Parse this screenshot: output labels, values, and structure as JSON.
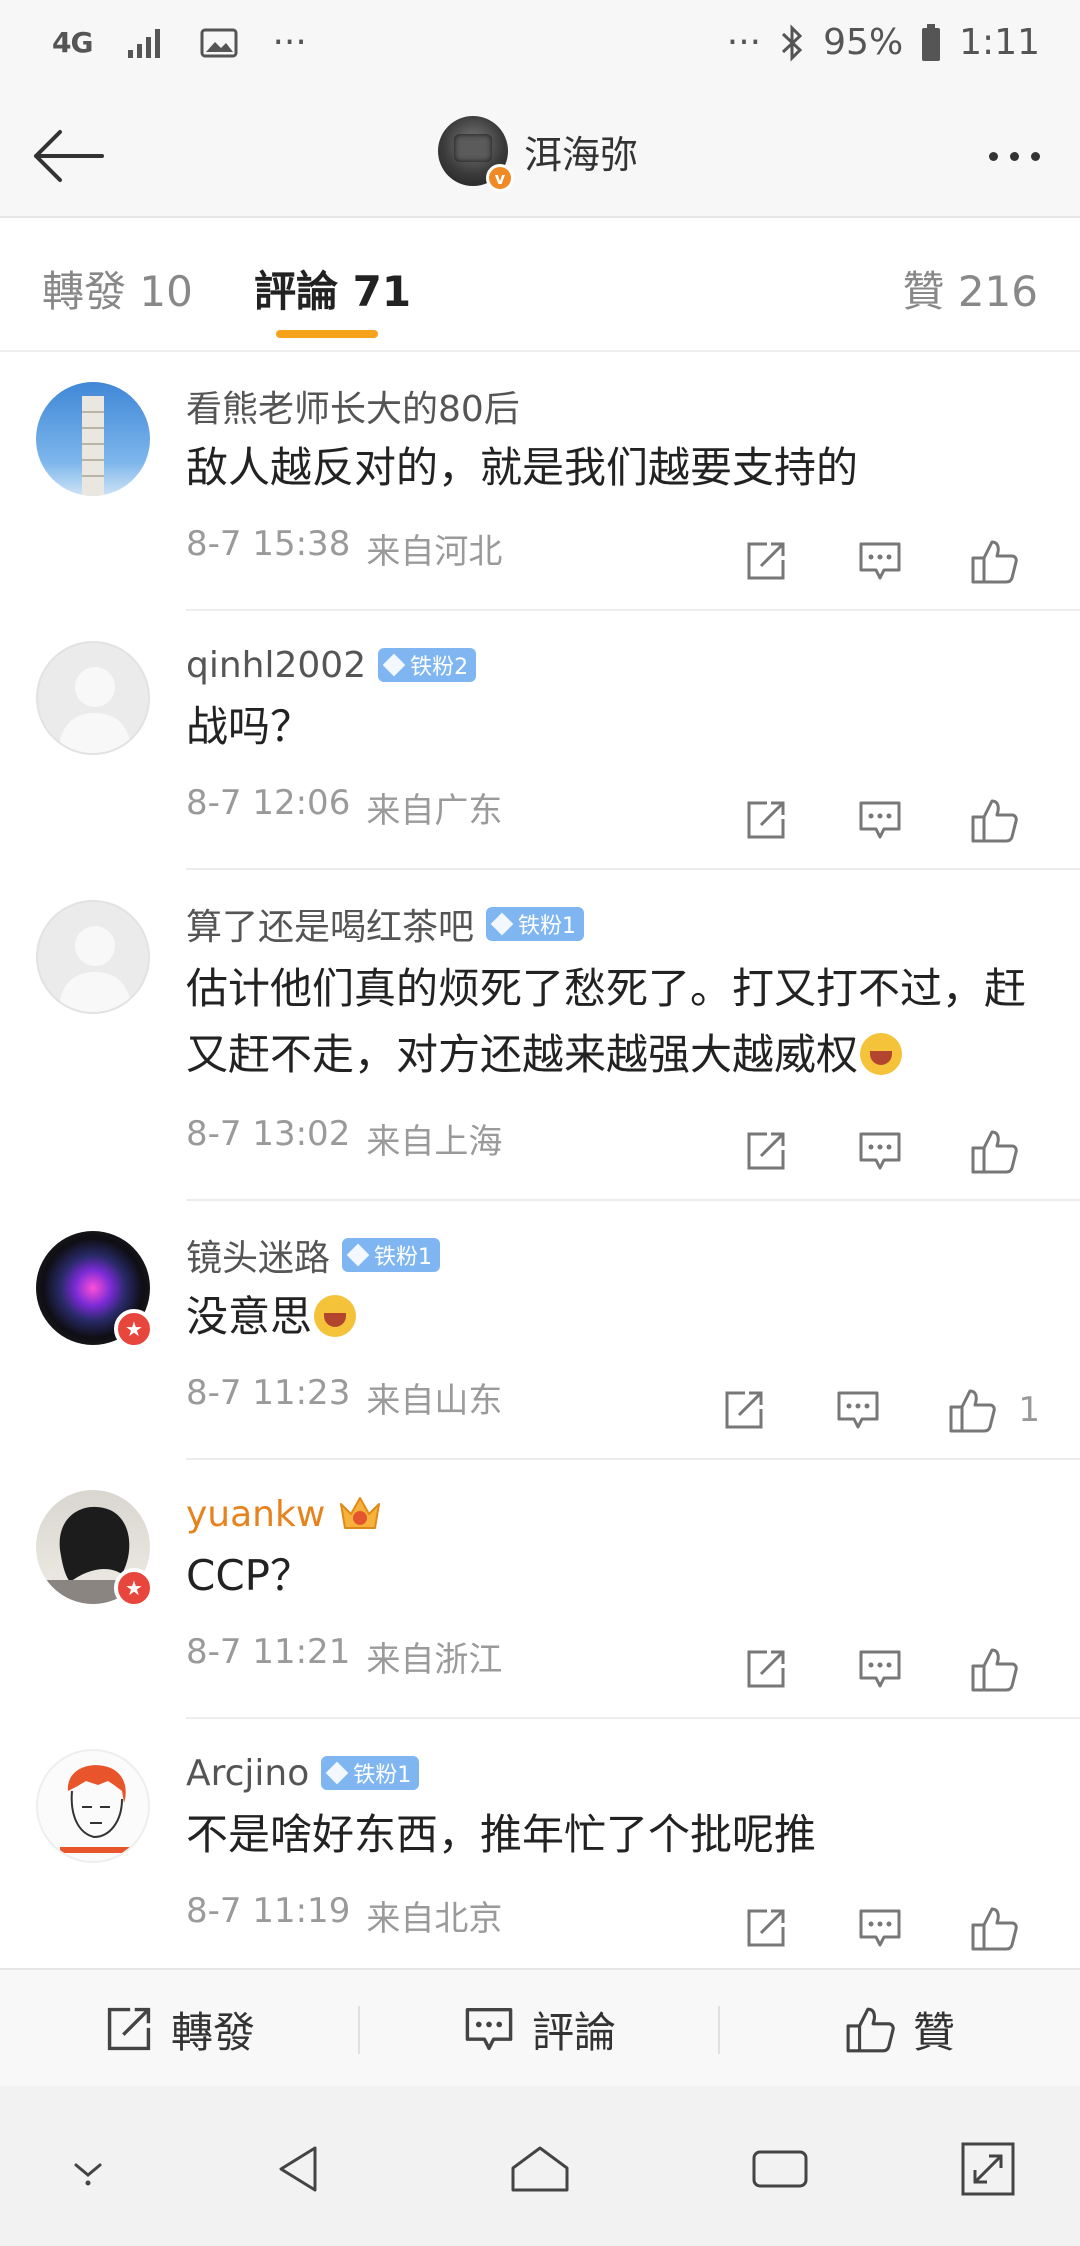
{
  "status_bar": {
    "network": "4G",
    "dots_left": "···",
    "dots_right": "···",
    "battery": "95%",
    "time": "1:11"
  },
  "nav": {
    "title": "洱海弥",
    "verified_mark": "v"
  },
  "tabs": [
    {
      "label": "轉發 10"
    },
    {
      "label": "評論 71"
    },
    {
      "label": "贊 216"
    }
  ],
  "comments": [
    {
      "user": "看熊老师长大的80后",
      "badge": "",
      "text": "敌人越反对的，就是我们越要支持的",
      "date": "8-7 15:38",
      "location": "来自河北",
      "likes": ""
    },
    {
      "user": "qinhl2002",
      "badge": "铁粉2",
      "text": "战吗？",
      "date": "8-7 12:06",
      "location": "来自广东",
      "likes": ""
    },
    {
      "user": "算了还是喝红茶吧",
      "badge": "铁粉1",
      "text": "估计他们真的烦死了愁死了。打又打不过，赶又赶不走，对方还越来越强大越威权",
      "date": "8-7 13:02",
      "location": "来自上海",
      "likes": ""
    },
    {
      "user": "镜头迷路",
      "badge": "铁粉1",
      "text": "没意思",
      "date": "8-7 11:23",
      "location": "来自山东",
      "likes": "1"
    },
    {
      "user": "yuankw",
      "badge": "",
      "text": "CCP？",
      "date": "8-7 11:21",
      "location": "来自浙江",
      "likes": ""
    },
    {
      "user": "Arcjino",
      "badge": "铁粉1",
      "text": "不是啥好东西，推年忙了个批呢推",
      "date": "8-7 11:19",
      "location": "来自北京",
      "likes": ""
    }
  ],
  "bottom_bar": {
    "repost": "轉發",
    "comment": "評論",
    "like": "贊"
  },
  "colors": {
    "accent": "#f7a21b",
    "vip_name": "#e6831d",
    "fan_badge": "#7fb6f2",
    "star_badge": "#e8463c"
  }
}
